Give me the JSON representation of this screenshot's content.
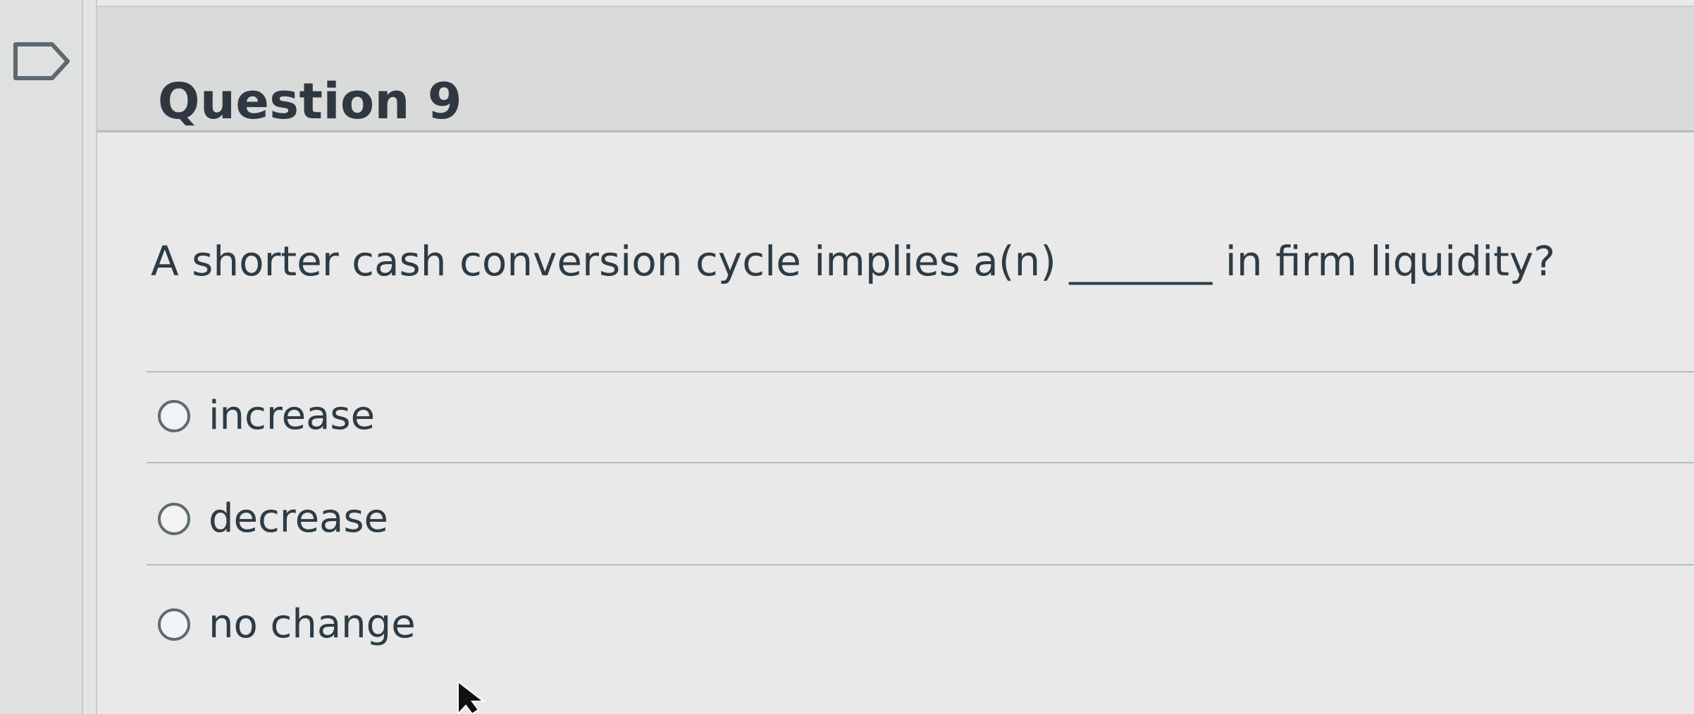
{
  "question": {
    "title": "Question 9",
    "text": "A shorter cash conversion cycle implies a(n) _______ in firm liquidity?"
  },
  "answers": [
    {
      "label": "increase",
      "selected": false
    },
    {
      "label": "decrease",
      "selected": false
    },
    {
      "label": "no change",
      "selected": false
    }
  ],
  "icons": {
    "flag": "bookmark-flag-icon",
    "radio": "radio-button-icon",
    "cursor": "mouse-pointer-icon"
  },
  "colors": {
    "page_background": "#e4e6e5",
    "header_background": "#d9dbdb",
    "text": "#2d3b45",
    "radio_border": "#5f6b73",
    "divider": "#b8bbbb"
  }
}
